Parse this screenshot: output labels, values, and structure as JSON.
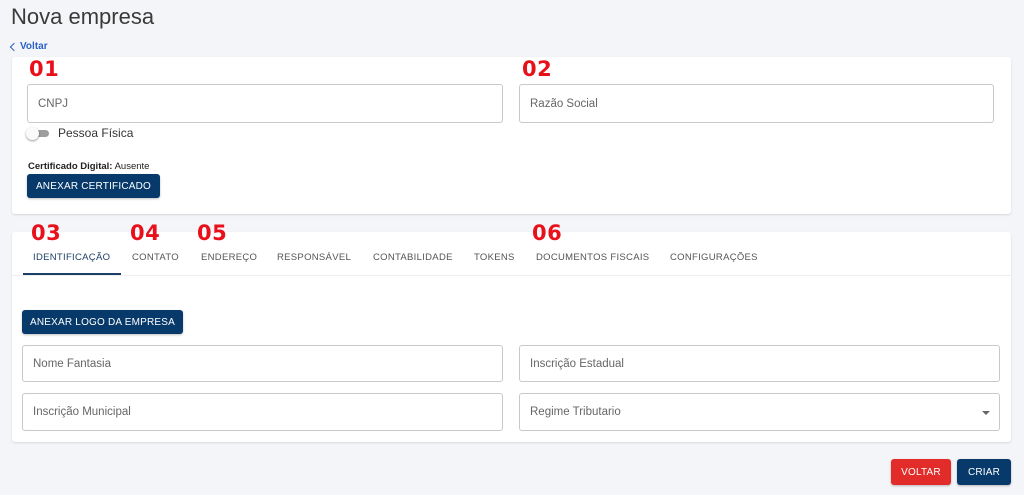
{
  "page": {
    "title": "Nova empresa",
    "back_label": "Voltar"
  },
  "annotations": {
    "n01": "01",
    "n02": "02",
    "n03": "03",
    "n04": "04",
    "n05": "05",
    "n06": "06"
  },
  "company": {
    "cnpj_placeholder": "CNPJ",
    "razao_social_placeholder": "Razão Social",
    "pessoa_fisica_label": "Pessoa Física",
    "pessoa_fisica_on": false,
    "certificado_label": "Certificado Digital:",
    "certificado_status": "Ausente",
    "anexar_certificado_label": "ANEXAR CERTIFICADO"
  },
  "tabs": [
    {
      "label": "IDENTIFICAÇÃO",
      "active": true
    },
    {
      "label": "CONTATO"
    },
    {
      "label": "ENDEREÇO"
    },
    {
      "label": "RESPONSÁVEL"
    },
    {
      "label": "CONTABILIDADE"
    },
    {
      "label": "TOKENS"
    },
    {
      "label": "DOCUMENTOS FISCAIS"
    },
    {
      "label": "CONFIGURAÇÕES"
    }
  ],
  "identificacao": {
    "anexar_logo_label": "ANEXAR LOGO DA EMPRESA",
    "nome_fantasia_placeholder": "Nome Fantasia",
    "inscricao_estadual_placeholder": "Inscrição Estadual",
    "inscricao_municipal_placeholder": "Inscrição Municipal",
    "regime_tributario_placeholder": "Regime Tributario"
  },
  "footer": {
    "voltar_label": "VOLTAR",
    "criar_label": "CRIAR"
  },
  "colors": {
    "navy": "#073a6b",
    "red": "#e22c29",
    "annotation": "#e8101b",
    "link": "#2a62c9"
  }
}
